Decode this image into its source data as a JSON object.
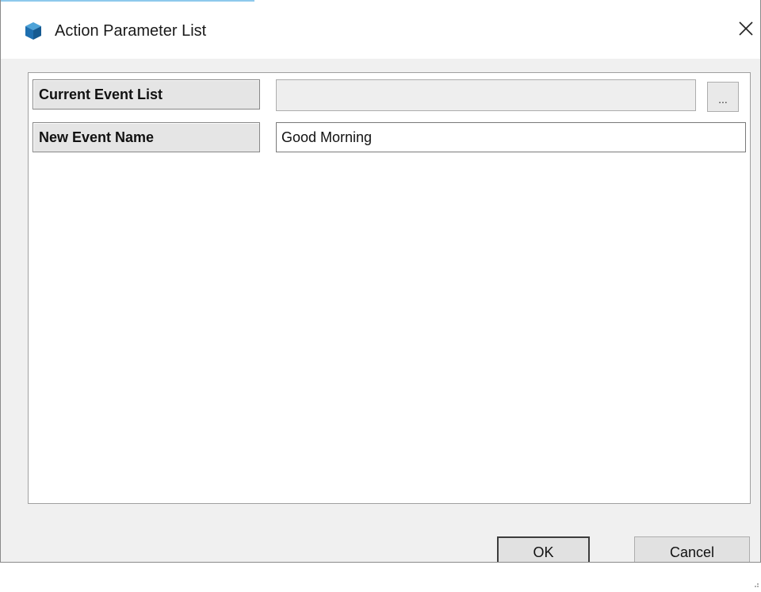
{
  "window": {
    "title": "Action Parameter List",
    "close_icon": "close-icon",
    "app_icon": "cube-icon",
    "app_icon_color": "#1e6fb0"
  },
  "params": {
    "current_event_list": {
      "label": "Current Event List",
      "value": "",
      "browse_label": "..."
    },
    "new_event_name": {
      "label": "New Event Name",
      "value": "Good Morning"
    }
  },
  "buttons": {
    "ok": "OK",
    "cancel": "Cancel"
  }
}
